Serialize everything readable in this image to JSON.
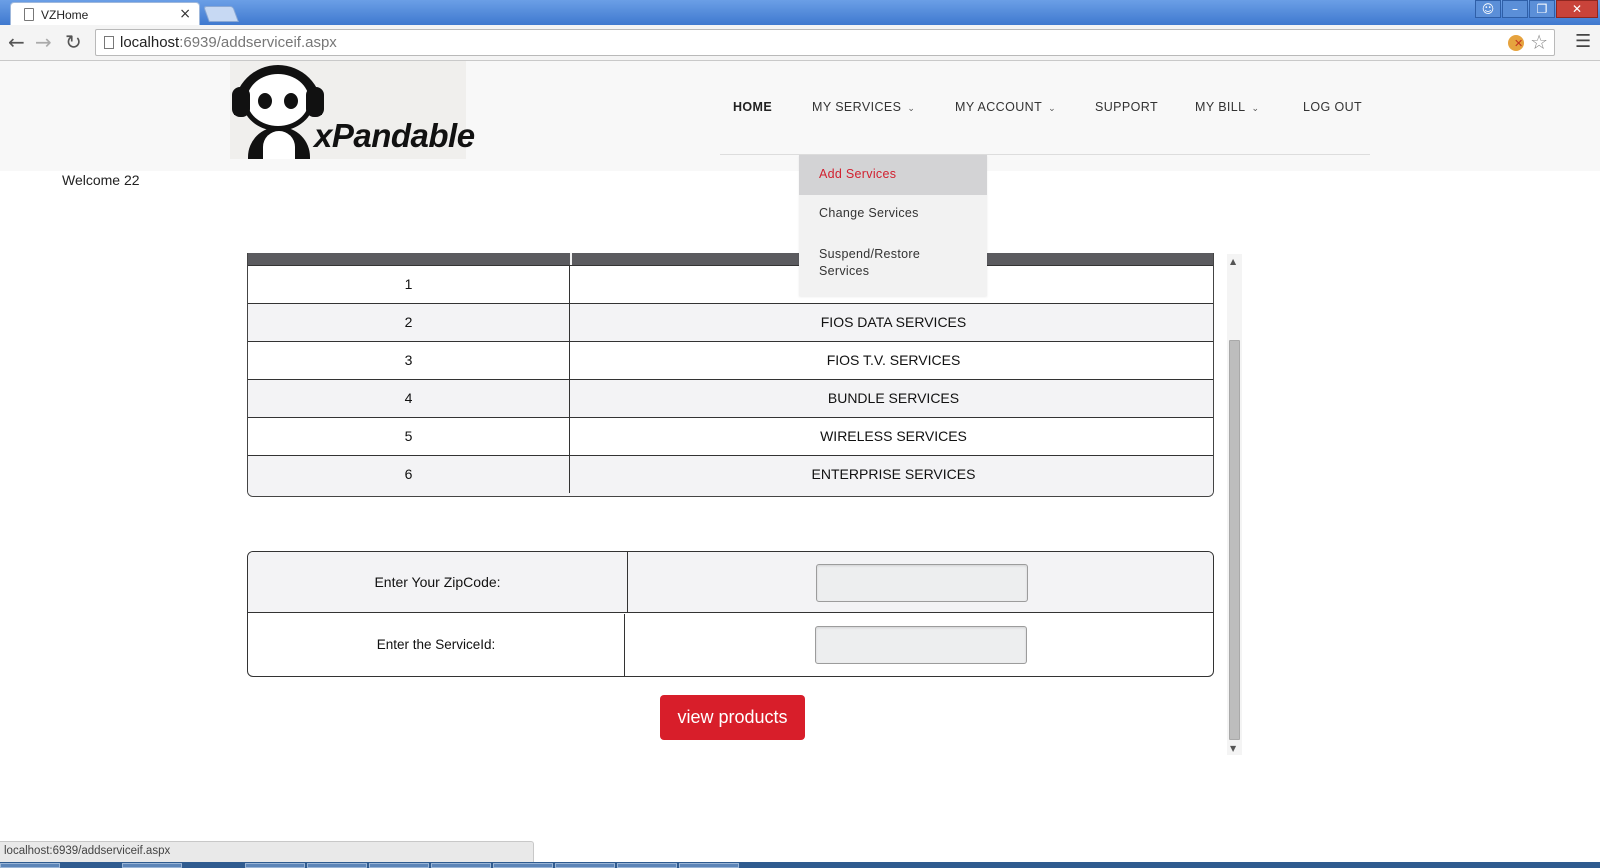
{
  "browser": {
    "tab_title": "VZHome",
    "tab_close": "×",
    "url_host": "localhost",
    "url_path": ":6939/addserviceif.aspx",
    "status_text": "localhost:6939/addserviceif.aspx",
    "icons": {
      "back": "arrow-left-icon",
      "forward": "arrow-right-icon",
      "reload": "reload-icon",
      "star": "star-icon",
      "menu": "hamburger-menu-icon"
    }
  },
  "header": {
    "logo_text": "xPandable",
    "nav": {
      "home": "HOME",
      "my_services": "MY SERVICES",
      "my_account": "MY ACCOUNT",
      "support": "SUPPORT",
      "my_bill": "MY BILL",
      "log_out": "LOG OUT"
    },
    "services_menu": {
      "add": "Add Services",
      "change": "Change Services",
      "suspend": "Suspend/Restore Services"
    }
  },
  "welcome": "Welcome 22",
  "services_table": {
    "rows": [
      {
        "id": "1",
        "name": ""
      },
      {
        "id": "2",
        "name": "FIOS DATA SERVICES"
      },
      {
        "id": "3",
        "name": "FIOS T.V. SERVICES"
      },
      {
        "id": "4",
        "name": "BUNDLE SERVICES"
      },
      {
        "id": "5",
        "name": "WIRELESS SERVICES"
      },
      {
        "id": "6",
        "name": "ENTERPRISE SERVICES"
      }
    ]
  },
  "form": {
    "zip_label": "Enter Your ZipCode:",
    "zip_value": "",
    "serviceid_label": "Enter the ServiceId:",
    "serviceid_value": "",
    "submit_label": "view products"
  },
  "colors": {
    "accent_red": "#d81e2a",
    "header_gray": "#5b5b5f",
    "titlebar_blue": "#3f79cf"
  }
}
